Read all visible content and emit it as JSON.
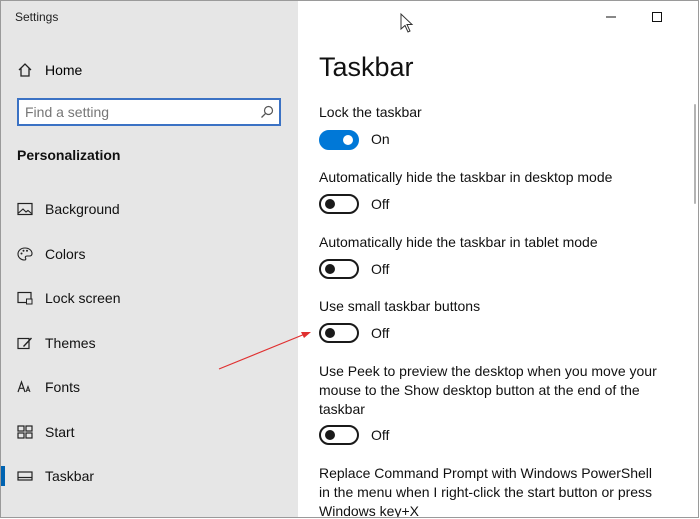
{
  "window": {
    "title": "Settings"
  },
  "sidebar": {
    "home_label": "Home",
    "search_placeholder": "Find a setting",
    "section_title": "Personalization",
    "items": [
      {
        "label": "Background",
        "icon": "picture-icon"
      },
      {
        "label": "Colors",
        "icon": "palette-icon"
      },
      {
        "label": "Lock screen",
        "icon": "lock-screen-icon"
      },
      {
        "label": "Themes",
        "icon": "themes-icon"
      },
      {
        "label": "Fonts",
        "icon": "fonts-icon"
      },
      {
        "label": "Start",
        "icon": "start-icon"
      },
      {
        "label": "Taskbar",
        "icon": "taskbar-icon",
        "selected": true
      }
    ]
  },
  "main": {
    "title": "Taskbar",
    "settings": [
      {
        "label": "Lock the taskbar",
        "state": "On"
      },
      {
        "label": "Automatically hide the taskbar in desktop mode",
        "state": "Off"
      },
      {
        "label": "Automatically hide the taskbar in tablet mode",
        "state": "Off"
      },
      {
        "label": "Use small taskbar buttons",
        "state": "Off"
      },
      {
        "label": "Use Peek to preview the desktop when you move your mouse to the Show desktop button at the end of the taskbar",
        "state": "Off"
      },
      {
        "label": "Replace Command Prompt with Windows PowerShell in the menu when I right-click the start button or press Windows key+X"
      }
    ]
  },
  "colors": {
    "accent": "#0078d7",
    "sidebar_bg": "#e6e6e6",
    "selection_bar": "#0063b1",
    "annotation_arrow": "#e03030"
  }
}
